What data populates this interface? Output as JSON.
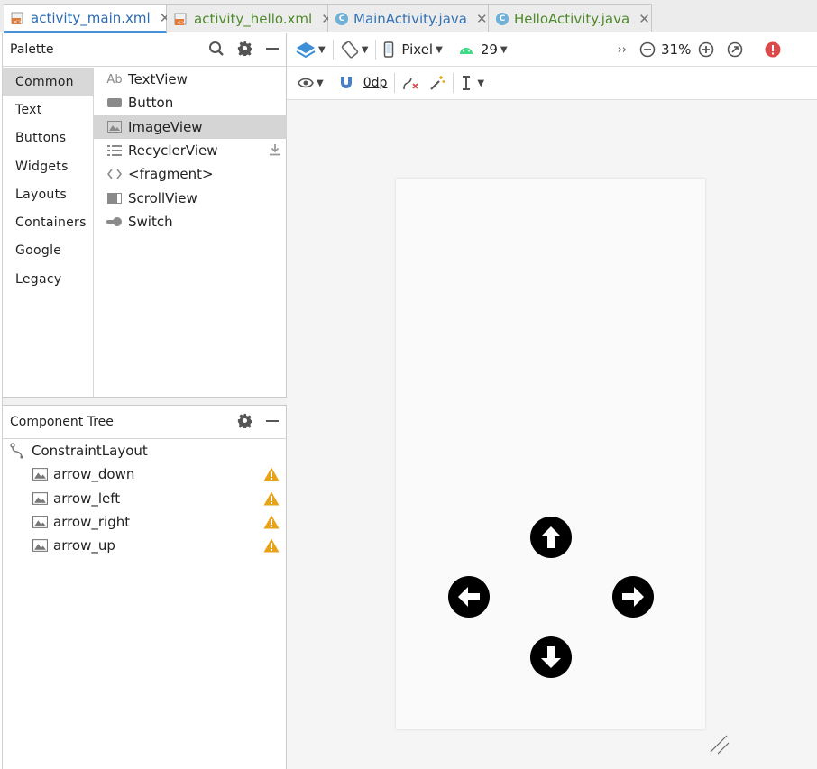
{
  "tabs": [
    {
      "label": "activity_main.xml",
      "kind": "xml",
      "active": true
    },
    {
      "label": "activity_hello.xml",
      "kind": "xml",
      "active": false
    },
    {
      "label": "MainActivity.java",
      "kind": "java",
      "active": false
    },
    {
      "label": "HelloActivity.java",
      "kind": "java",
      "active": false
    }
  ],
  "tab_close": "✕",
  "palette": {
    "title": "Palette",
    "categories": [
      "Common",
      "Text",
      "Buttons",
      "Widgets",
      "Layouts",
      "Containers",
      "Google",
      "Legacy"
    ],
    "selected_category": "Common",
    "widgets": [
      {
        "label": "TextView",
        "icon": "textview-icon",
        "icon_text": "Ab"
      },
      {
        "label": "Button",
        "icon": "button-icon"
      },
      {
        "label": "ImageView",
        "icon": "imageview-icon",
        "selected": true
      },
      {
        "label": "RecyclerView",
        "icon": "recyclerview-icon",
        "download": true
      },
      {
        "label": "<fragment>",
        "icon": "fragment-icon"
      },
      {
        "label": "ScrollView",
        "icon": "scrollview-icon"
      },
      {
        "label": "Switch",
        "icon": "switch-icon"
      }
    ]
  },
  "component_tree": {
    "title": "Component Tree",
    "root": "ConstraintLayout",
    "children": [
      "arrow_down",
      "arrow_left",
      "arrow_right",
      "arrow_up"
    ]
  },
  "toolbar": {
    "device": "Pixel",
    "api": "29",
    "zoom": "31%",
    "margin": "0dp",
    "overflow": "››"
  },
  "colors": {
    "accent": "#4a90d9",
    "warning": "#e8a317",
    "error": "#db4b4b",
    "android_green": "#3ddc84"
  }
}
